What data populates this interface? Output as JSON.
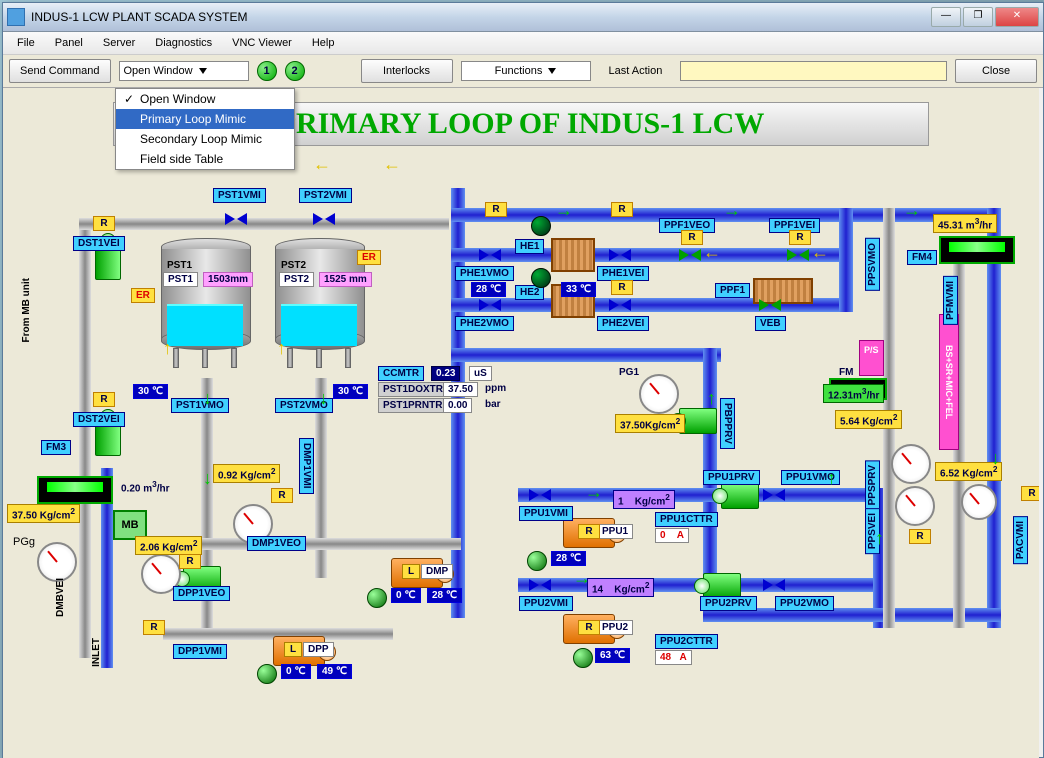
{
  "window": {
    "title": "INDUS-1 LCW PLANT SCADA SYSTEM"
  },
  "menu": {
    "items": [
      "File",
      "Panel",
      "Server",
      "Diagnostics",
      "VNC Viewer",
      "Help"
    ]
  },
  "toolbar": {
    "send": "Send Command",
    "openwin": "Open Window",
    "ind1": "1",
    "ind2": "2",
    "interlocks": "Interlocks",
    "functions": "Functions",
    "lastaction": "Last Action",
    "close": "Close"
  },
  "dropdown": {
    "items": [
      "Open Window",
      "Primary Loop Mimic",
      "Secondary Loop Mimic",
      "Field side Table"
    ],
    "selected": 1,
    "checked": 0
  },
  "page_title": "PRIMARY LOOP OF INDUS-1 LCW",
  "tags": {
    "pst1vmi": "PST1VMI",
    "pst2vmi": "PST2VMI",
    "dst1vei": "DST1VEI",
    "dst2vei": "DST2VEI",
    "pst1": "PST1",
    "pst2": "PST2",
    "pst1_lbl": "PST1",
    "pst2_lbl": "PST2",
    "phe1vmo": "PHE1VMO",
    "phe1vei": "PHE1VEI",
    "phe2vmo": "PHE2VMO",
    "phe2vei": "PHE2VEI",
    "he1": "HE1",
    "he2": "HE2",
    "ppf1veo": "PPF1VEO",
    "ppf1vei": "PPF1VEI",
    "ppf1": "PPF1",
    "veb": "VEB",
    "pst1vmo": "PST1VMO",
    "pst2vmo": "PST2VMO",
    "dmp1vmi": "DMP1VMI",
    "dmp1veo": "DMP1VEO",
    "dmp": "DMP",
    "dpp": "DPP",
    "dpp1veo": "DPP1VEO",
    "dpp1vmi": "DPP1VMI",
    "ppu1vmi": "PPU1VMI",
    "ppu1prv": "PPU1PRV",
    "ppu1vmo": "PPU1VMO",
    "ppu1": "PPU1",
    "ppu1cttr": "PPU1CTTR",
    "ppu2vmi": "PPU2VMI",
    "ppu2prv": "PPU2PRV",
    "ppu2vmo": "PPU2VMO",
    "ppu2": "PPU2",
    "ppu2cttr": "PPU2CTTR",
    "pbpprv": "PBPPRV",
    "pg1": "PG1",
    "fm3": "FM3",
    "fm4": "FM4",
    "fm": "FM",
    "ccmtr": "CCMTR",
    "pst1doxtr": "PST1DOXTR",
    "pst1prntr": "PST1PRNTR",
    "dmbvei": "DMBVEI",
    "inlet": "INLET",
    "pgg": "PGg",
    "mb": "MB",
    "ppsvmo": "PPSVMO",
    "pfmvmi": "PFMVMI",
    "ppsprv": "PPSPRV",
    "ppsvei": "PPSVEI",
    "pacvmi": "PACVMI",
    "from_mb": "From MB unit",
    "ps": "P/S",
    "fel": "BS+SR+MIC+FEL",
    "er": "ER",
    "r": "R",
    "l": "L"
  },
  "values": {
    "pst1_mm": "1503mm",
    "pst2_mm": "1525 mm",
    "t30a": "30 ℃",
    "t30b": "30 ℃",
    "t28": "28 ℃",
    "t33": "33 ℃",
    "t0a": "0 ℃",
    "t49": "49 ℃",
    "t0b": "0 ℃",
    "t28b": "28 ℃",
    "t63": "63 ℃",
    "cc_v": "0.23",
    "cc_u": "uS",
    "dox_v": "37.50",
    "dox_u": "ppm",
    "prn_v": "0.00",
    "prn_u": "bar",
    "kg092": "0.92   Kg/cm",
    "kg206": "2.06   Kg/cm",
    "kg375": "37.50   Kg/cm",
    "kg375b": "37.50Kg/cm",
    "kg1": "1",
    "kg14": "14",
    "kgcm": "Kg/cm",
    "sq": "2",
    "fm3_v": "0.20 m",
    "fm4_v": "45.31 m",
    "fm_v": "12.31m",
    "perhr": "/hr",
    "cub": "3",
    "kg564": "5.64    Kg/cm",
    "kg652": "6.52    Kg/cm",
    "ppu1_a": "0",
    "ppu2_a": "48",
    "amp": "A"
  }
}
